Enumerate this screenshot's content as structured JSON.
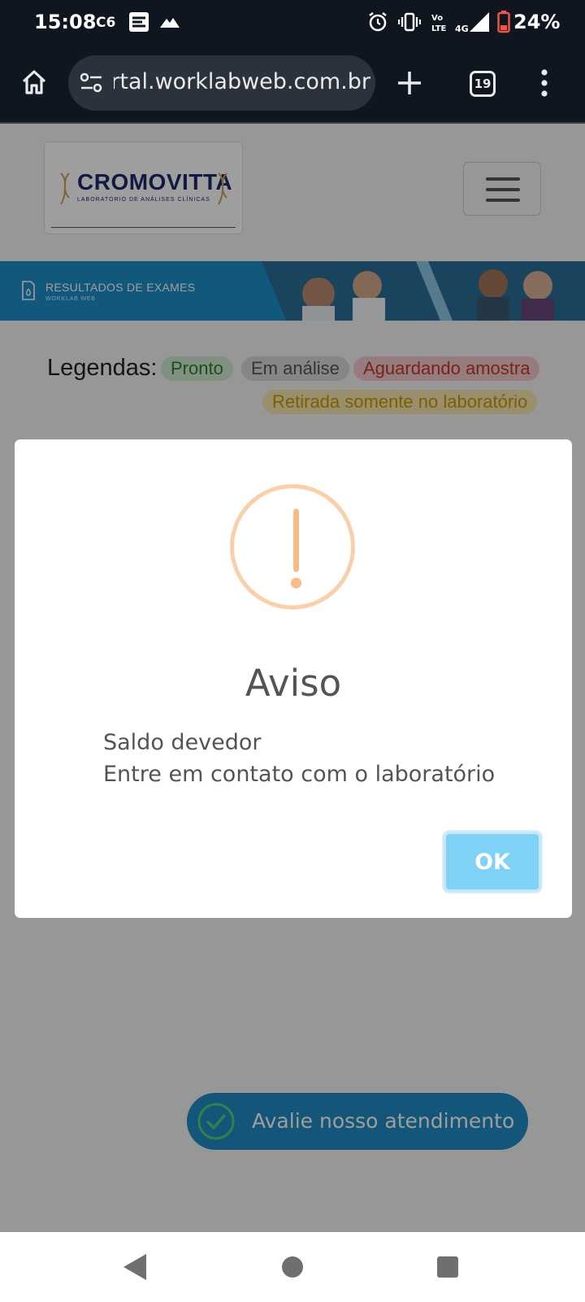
{
  "status_bar": {
    "time": "15:08",
    "battery": "24%",
    "icons": [
      "c6-icon",
      "app-icon",
      "mountain-icon",
      "alarm-icon",
      "vibrate-icon",
      "volte-icon",
      "signal-4g-icon",
      "battery-icon"
    ]
  },
  "browser": {
    "url": "portal.worklabweb.com.br",
    "tab_count": "19",
    "icons": [
      "home-icon",
      "site-settings-icon",
      "new-tab-icon",
      "tabs-icon",
      "more-menu-icon"
    ]
  },
  "page": {
    "logo_name": "CROMOVITTA",
    "logo_subtitle": "LABORATÓRIO DE ANÁLISES CLÍNICAS",
    "banner_title": "RESULTADOS DE EXAMES",
    "banner_subtitle": "WORKLAB WEB",
    "legend_label": "Legendas:",
    "legend": {
      "ready": "Pronto",
      "analysis": "Em análise",
      "waiting": "Aguardando amostra",
      "pickup": "Retirada somente no laboratório"
    },
    "rating_button": "Avalie nosso atendimento"
  },
  "modal": {
    "title": "Aviso",
    "line1": "Saldo devedor",
    "line2": "Entre em contato com o laboratório",
    "ok_label": "OK"
  },
  "colors": {
    "brand_blue": "#1d8fca",
    "warning": "#f8bb86",
    "ok_button": "#7fd1f5"
  }
}
